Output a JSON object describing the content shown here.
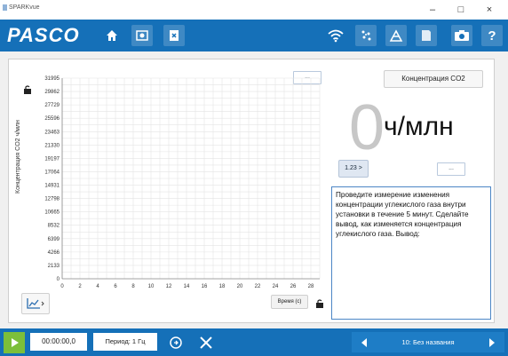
{
  "window": {
    "title": "SPARKvue",
    "controls": {
      "minimize": "–",
      "maximize": "□",
      "close": "×"
    }
  },
  "toolbar": {
    "logo": "PASCO",
    "left_icons": [
      "home-icon",
      "camera-capture-icon",
      "export-icon"
    ],
    "right_icons": [
      "wifi-icon",
      "sensor-dots-icon",
      "calibrate-icon",
      "journal-icon",
      "snapshot-icon",
      "help-icon"
    ],
    "help_label": "?"
  },
  "graph": {
    "y_axis_label": "Концентрация CO2 ч/млн",
    "x_axis_label": "Время (с)",
    "top_dots": "...",
    "chart_data": {
      "type": "line",
      "xlabel": "Время (с)",
      "ylabel": "Концентрация CO2 ч/млн",
      "x_ticks": [
        0,
        2,
        4,
        6,
        8,
        10,
        12,
        14,
        16,
        18,
        20,
        22,
        24,
        26,
        28
      ],
      "y_ticks": [
        0,
        2133,
        4266,
        6399,
        8532,
        10665,
        12798,
        14931,
        17064,
        19197,
        21330,
        23463,
        25596,
        27729,
        29862,
        31995
      ],
      "y_tick_labels": [
        "0",
        "2133",
        "4266",
        "6399",
        "8532",
        "10665",
        "12798",
        "14931",
        "17064",
        "19197",
        "21330",
        "23463",
        "25596",
        "27729",
        "29862",
        "31995"
      ],
      "xlim": [
        0,
        29
      ],
      "ylim": [
        0,
        31995
      ],
      "grid": true,
      "series": []
    }
  },
  "digits": {
    "title": "Концентрация CO2",
    "value": "0",
    "unit": "ч/млн",
    "format_button": "1.23 >",
    "dots": "..."
  },
  "text_box": {
    "content": "Проведите измерение изменения концентрации углекислого газа внутри установки в течение 5 минут. Сделайте вывод, как изменяется концентрация углекислого газа. Вывод:"
  },
  "bottom": {
    "time": "00:00:00,0",
    "period": "Период: 1 Гц",
    "page": "10: Без названия"
  },
  "colors": {
    "accent": "#1570b8",
    "play": "#7cbf3a"
  }
}
